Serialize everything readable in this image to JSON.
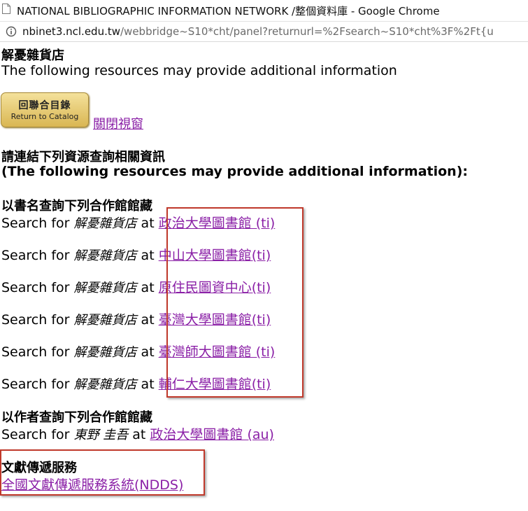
{
  "window": {
    "title": "NATIONAL BIBLIOGRAPHIC INFORMATION NETWORK /整個資料庫 - Google Chrome",
    "url_host": "nbinet3.ncl.edu.tw",
    "url_path": "/webbridge~S10*cht/panel?returnurl=%2Fsearch~S10*cht%3F%2Ft{u"
  },
  "page": {
    "title": "解憂雜貨店",
    "subtitle": "The following resources may provide additional information",
    "return_button": {
      "zh": "回聯合目錄",
      "en": "Return to Catalog"
    },
    "close_link": "關閉視窗",
    "intro_zh": "請連結下列資源查詢相關資訊",
    "intro_en": "(The following resources may provide additional information):"
  },
  "title_section": {
    "heading": "以書名查詢下列合作館館藏",
    "search_prefix": "Search for",
    "query": "解憂雜貨店",
    "at": "at",
    "links": [
      "政治大學圖書館 (ti)",
      "中山大學圖書館(ti)",
      "原住民圖資中心(ti)",
      "臺灣大學圖書館(ti)",
      "臺灣師大圖書館 (ti)",
      "輔仁大學圖書館(ti)"
    ]
  },
  "author_section": {
    "heading": "以作者查詢下列合作館館藏",
    "search_prefix": "Search for",
    "query": "東野 圭吾",
    "at": "at",
    "link": "政治大學圖書館 (au)"
  },
  "delivery_section": {
    "heading": "文獻傳遞服務",
    "link": "全國文獻傳遞服務系統(NDDS)"
  },
  "colors": {
    "link": "#8a1fa6",
    "highlight_box": "#c0392b",
    "button_gold": "#d9b653"
  },
  "icons": {
    "tab": "document-icon",
    "address": "info-icon"
  }
}
